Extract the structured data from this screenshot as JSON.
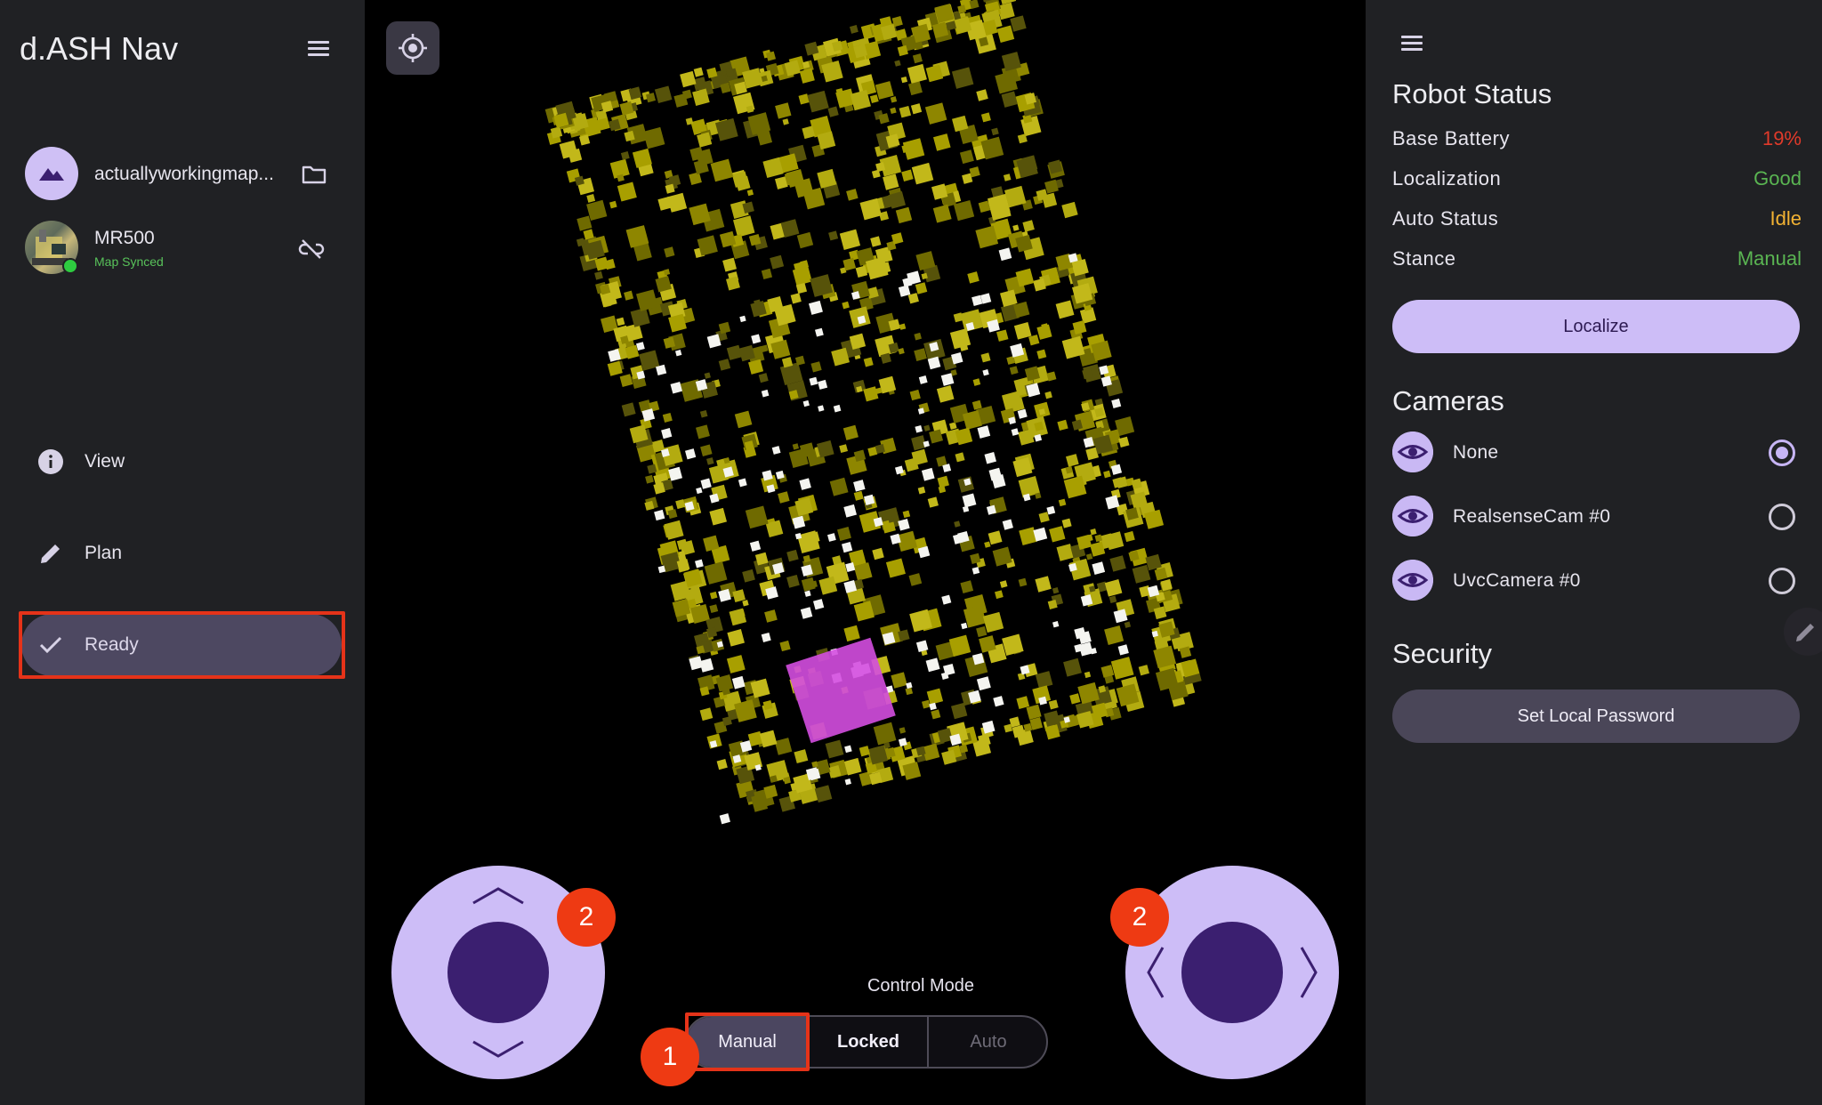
{
  "app": {
    "title": "d.ASH Nav"
  },
  "sidebar": {
    "map": {
      "name": "actuallyworkingmap..."
    },
    "robot": {
      "name": "MR500",
      "status": "Map Synced"
    },
    "nav": [
      {
        "label": "View",
        "icon": "info-icon"
      },
      {
        "label": "Plan",
        "icon": "pencil-icon"
      },
      {
        "label": "Ready",
        "icon": "check-icon",
        "selected": true
      }
    ]
  },
  "viewer": {
    "control_mode_label": "Control Mode",
    "modes": [
      {
        "label": "Manual",
        "selected": true
      },
      {
        "label": "Locked",
        "selected": false
      },
      {
        "label": "Auto",
        "enabled": false
      }
    ],
    "annotations": {
      "mode_badge": "1",
      "left_joystick_badge": "2",
      "right_joystick_badge": "2"
    }
  },
  "robot_status": {
    "title": "Robot Status",
    "rows": [
      {
        "key": "Base Battery",
        "value": "19%",
        "color": "#e03a2a"
      },
      {
        "key": "Localization",
        "value": "Good",
        "color": "#5ab552"
      },
      {
        "key": "Auto Status",
        "value": "Idle",
        "color": "#f2b233"
      },
      {
        "key": "Stance",
        "value": "Manual",
        "color": "#5ab552"
      }
    ],
    "localize_label": "Localize"
  },
  "cameras": {
    "title": "Cameras",
    "items": [
      {
        "name": "None",
        "selected": true
      },
      {
        "name": "RealsenseCam #0",
        "selected": false
      },
      {
        "name": "UvcCamera #0",
        "selected": false
      }
    ]
  },
  "security": {
    "title": "Security",
    "password_label": "Set Local Password"
  },
  "colors": {
    "accent": "#cdbdf7",
    "selected_bg": "#4d4861",
    "highlight": "#e53319",
    "map_voxel": "#a8a000"
  }
}
